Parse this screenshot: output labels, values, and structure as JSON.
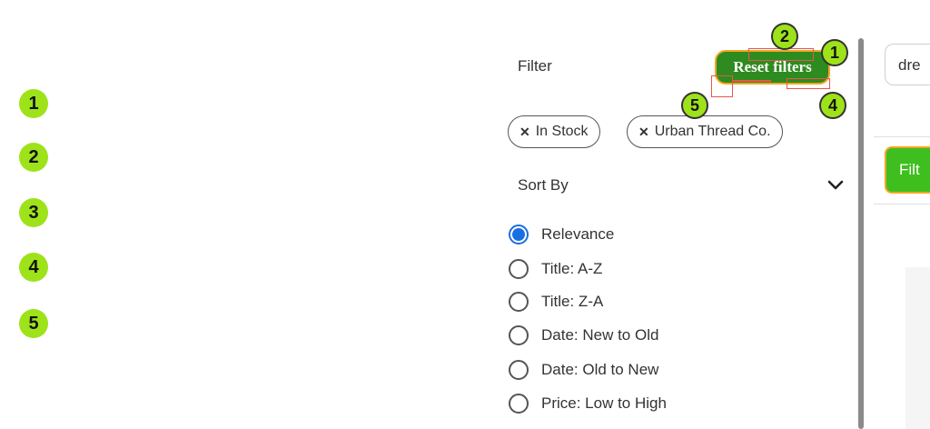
{
  "markers": [
    "1",
    "2",
    "3",
    "4",
    "5"
  ],
  "filter_panel": {
    "title": "Filter",
    "reset_label": "Reset filters",
    "chips": [
      {
        "icon": "close-icon",
        "label": "In Stock"
      },
      {
        "icon": "close-icon",
        "label": "Urban Thread Co."
      }
    ],
    "sort_by": {
      "label": "Sort By",
      "icon": "chevron-down-icon",
      "options": [
        {
          "label": "Relevance",
          "checked": true
        },
        {
          "label": "Title: A-Z",
          "checked": false
        },
        {
          "label": "Title: Z-A",
          "checked": false
        },
        {
          "label": "Date: New to Old",
          "checked": false
        },
        {
          "label": "Date: Old to New",
          "checked": false
        },
        {
          "label": "Price: Low to High",
          "checked": false
        }
      ]
    }
  },
  "annotations": [
    "1",
    "2",
    "4",
    "5"
  ],
  "right": {
    "search_value": "dre",
    "filter_button": "Filt"
  },
  "colors": {
    "marker_green": "#9ee21a",
    "reset_bg": "#2e8b1f",
    "reset_border": "#f5a623",
    "radio_checked": "#1a6fe0",
    "annotation_red": "#e8574d"
  }
}
